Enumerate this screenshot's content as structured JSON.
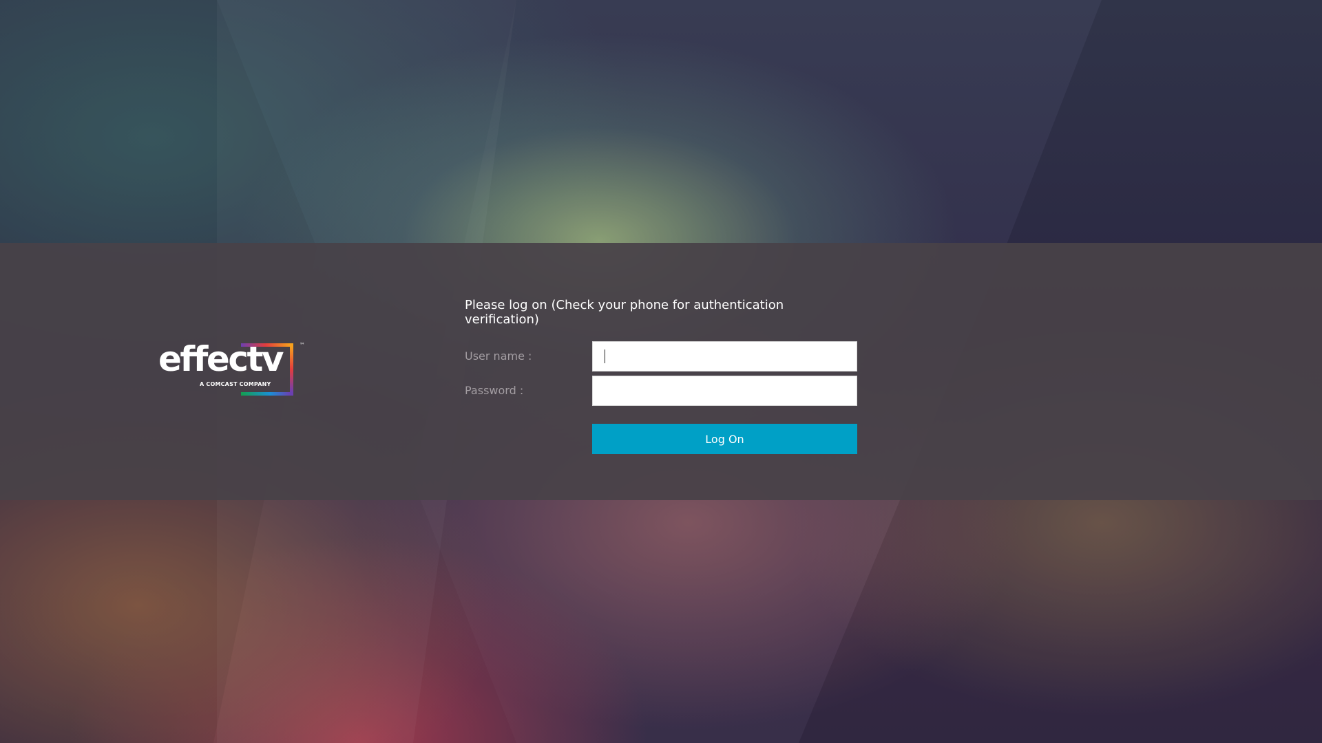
{
  "logo": {
    "wordmark": "effectv",
    "tagline": "A COMCAST COMPANY",
    "trademark": "™",
    "gradient_colors": [
      "#13a04a",
      "#1b8fd6",
      "#6b3fb2",
      "#e33d3d",
      "#f7a31c"
    ]
  },
  "login_form": {
    "heading": "Please log on (Check your phone for authentication verification)",
    "username_label": "User name :",
    "username_value": "",
    "password_label": "Password :",
    "password_value": "",
    "submit_label": "Log On"
  },
  "colors": {
    "band": "#484248",
    "button": "#00a0c6",
    "label": "#a39da2",
    "heading": "#ffffff"
  }
}
